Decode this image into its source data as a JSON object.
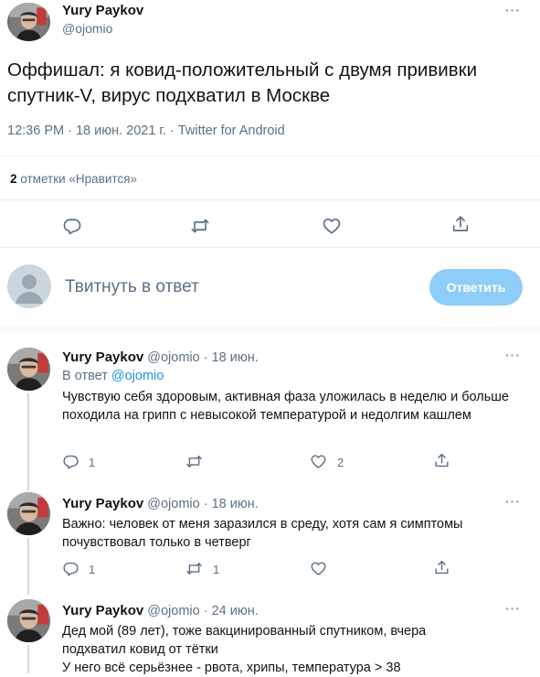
{
  "main_tweet": {
    "author_name": "Yury Paykov",
    "author_handle": "@ojomio",
    "more": "···",
    "text": "Оффишал: я ковид-положительный с двумя прививки спутник-V, вирус подхватил в Москве",
    "meta": "12:36 PM · 18 июн. 2021 г. · Twitter for Android",
    "likes_count": "2",
    "likes_label": "отметки «Нравится»"
  },
  "reply_box": {
    "placeholder": "Твитнуть в ответ",
    "button_label": "Ответить"
  },
  "replies": [
    {
      "author_name": "Yury Paykov",
      "handle_date": "@ojomio · 18 июн.",
      "reply_to_prefix": "В ответ",
      "reply_to_handle": "@ojomio",
      "text": "Чувствую себя здоровым, активная фаза уложилась в неделю и больше походила на грипп с невысокой температурой и недолгим кашлем",
      "comments": "1",
      "retweets": "",
      "likes": "2"
    },
    {
      "author_name": "Yury Paykov",
      "handle_date": "@ojomio · 18 июн.",
      "text": "Важно: человек от меня заразился в среду, хотя сам я симптомы почувствовал только в четверг",
      "comments": "1",
      "retweets": "1",
      "likes": ""
    },
    {
      "author_name": "Yury Paykov",
      "handle_date": "@ojomio · 24 июн.",
      "text": "Дед мой (89 лет), тоже вакцинированный спутником, вчера подхватил ковид от тётки\nУ него всё серьёзнее - рвота, хрипы, температура > 38"
    }
  ],
  "colors": {
    "accent": "#1d9bf0",
    "button_disabled": "#8ecdf8",
    "muted": "#5b7083",
    "divider": "#ebeef0"
  }
}
